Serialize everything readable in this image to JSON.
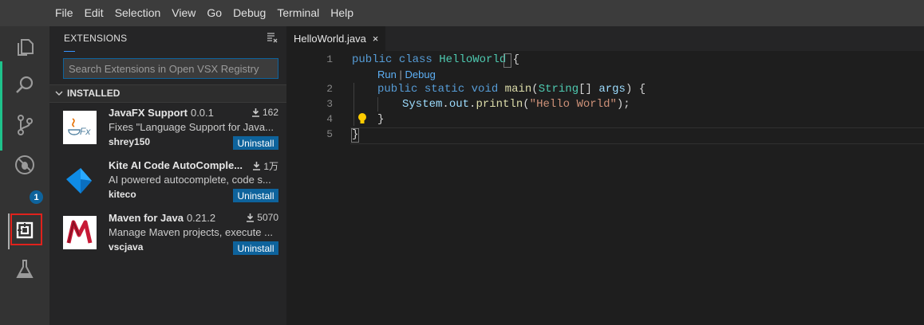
{
  "menubar": {
    "items": [
      "File",
      "Edit",
      "Selection",
      "View",
      "Go",
      "Debug",
      "Terminal",
      "Help"
    ]
  },
  "activity_bar": {
    "icons": [
      "explorer-icon",
      "search-icon",
      "source-control-icon",
      "debug-icon",
      "extensions-icon",
      "test-icon"
    ],
    "debug_badge": "1"
  },
  "sidebar": {
    "title": "EXTENSIONS",
    "search_placeholder": "Search Extensions in Open VSX Registry",
    "section_label": "INSTALLED",
    "extensions": [
      {
        "name": "JavaFX Support",
        "version": "0.0.1",
        "downloads": "162",
        "description": "Fixes \"Language Support for Java...",
        "publisher": "shrey150",
        "button": "Uninstall",
        "icon": "javafx-icon"
      },
      {
        "name": "Kite AI Code AutoComple...",
        "version": "",
        "downloads": "1万",
        "description": "AI powered autocomplete, code s...",
        "publisher": "kiteco",
        "button": "Uninstall",
        "icon": "kite-icon"
      },
      {
        "name": "Maven for Java",
        "version": "0.21.2",
        "downloads": "5070",
        "description": "Manage Maven projects, execute ...",
        "publisher": "vscjava",
        "button": "Uninstall",
        "icon": "maven-icon"
      }
    ]
  },
  "editor": {
    "tab_label": "HelloWorld.java",
    "tab_close": "×",
    "code_lens": {
      "run": "Run",
      "separator": "|",
      "debug": "Debug"
    },
    "line_numbers": [
      "1",
      "2",
      "3",
      "4",
      "5"
    ],
    "lines": {
      "l1": {
        "kw1": "public",
        "kw2": "class",
        "cls": "HelloWorld",
        "brace": "{"
      },
      "l2": {
        "kw1": "public",
        "kw2": "static",
        "kw3": "void",
        "fn": "main",
        "open": "(",
        "cls": "String",
        "arr": "[]",
        "var": "args",
        "close": ") {"
      },
      "l3": {
        "cls": "System",
        "dot1": ".",
        "var": "out",
        "dot2": ".",
        "fn": "println",
        "open": "(",
        "str": "\"Hello World\"",
        "close": ");"
      },
      "l4": {
        "brace": "}"
      },
      "l5": {
        "brace": "}"
      }
    }
  },
  "colors": {
    "accent": "#0e639c",
    "highlight_box": "#e0221c",
    "keyword": "#569cd6",
    "type": "#4ec9b0",
    "string": "#ce9178"
  }
}
